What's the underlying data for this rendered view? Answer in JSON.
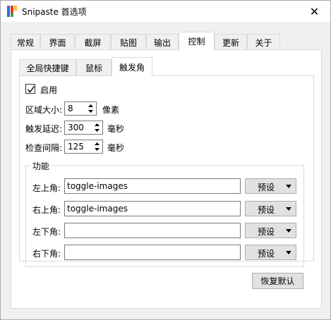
{
  "window": {
    "title": "Snipaste 首选项",
    "close_symbol": "✕"
  },
  "tabs": [
    {
      "label": "常规"
    },
    {
      "label": "界面"
    },
    {
      "label": "截屏"
    },
    {
      "label": "贴图"
    },
    {
      "label": "输出"
    },
    {
      "label": "控制",
      "active": true
    },
    {
      "label": "更新"
    },
    {
      "label": "关于"
    }
  ],
  "subtabs": [
    {
      "label": "全局快捷键"
    },
    {
      "label": "鼠标"
    },
    {
      "label": "触发角",
      "active": true
    }
  ],
  "enable": {
    "label": "启用",
    "checked": true
  },
  "area_size": {
    "label": "区域大小:",
    "value": "8",
    "unit": "像素"
  },
  "trigger_delay": {
    "label": "触发延迟:",
    "value": "300",
    "unit": "毫秒"
  },
  "check_interval": {
    "label": "检查间隔:",
    "value": "125",
    "unit": "毫秒"
  },
  "function_group": {
    "title": "功能",
    "rows": [
      {
        "label": "左上角:",
        "value": "toggle-images",
        "preset": "预设"
      },
      {
        "label": "右上角:",
        "value": "toggle-images",
        "preset": "预设"
      },
      {
        "label": "左下角:",
        "value": "",
        "preset": "预设"
      },
      {
        "label": "右下角:",
        "value": "",
        "preset": "预设"
      }
    ]
  },
  "restore_button": "恢复默认",
  "icons": {
    "app": "snipaste-logo-icon",
    "close": "close-icon",
    "check": "checkmark-icon",
    "up": "spin-up-icon",
    "down": "spin-down-icon",
    "caret": "dropdown-caret-icon"
  },
  "colors": {
    "panel": "#ffffff",
    "window_bg": "#f0f0f0",
    "button_bg": "#e1e1e1",
    "border": "#d9d9d9"
  }
}
